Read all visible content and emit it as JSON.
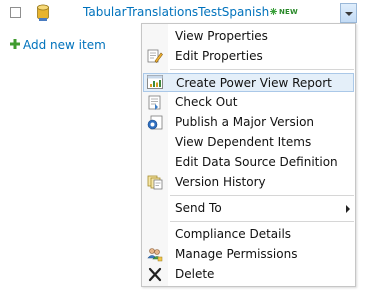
{
  "row": {
    "title": "TabularTranslationsTestSpanish",
    "new_badge": "NEW"
  },
  "add_new": {
    "label": "Add new item"
  },
  "menu": {
    "items": [
      {
        "label": "View Properties",
        "icon": "none"
      },
      {
        "label": "Edit Properties",
        "icon": "edit-properties-icon"
      },
      {
        "label": "Create Power View Report",
        "icon": "power-view-icon",
        "highlighted": true
      },
      {
        "label": "Check Out",
        "icon": "check-out-icon"
      },
      {
        "label": "Publish a Major Version",
        "icon": "publish-icon"
      },
      {
        "label": "View Dependent Items",
        "icon": "none"
      },
      {
        "label": "Edit Data Source Definition",
        "icon": "none"
      },
      {
        "label": "Version History",
        "icon": "version-history-icon"
      },
      {
        "label": "Send To",
        "icon": "none",
        "submenu": true
      },
      {
        "label": "Compliance Details",
        "icon": "none"
      },
      {
        "label": "Manage Permissions",
        "icon": "manage-permissions-icon"
      },
      {
        "label": "Delete",
        "icon": "delete-icon"
      }
    ]
  },
  "colors": {
    "link": "#0072bc",
    "highlight_bg": "#e4eff9",
    "highlight_border": "#aac8e8",
    "new_badge": "#2b8a2b"
  }
}
